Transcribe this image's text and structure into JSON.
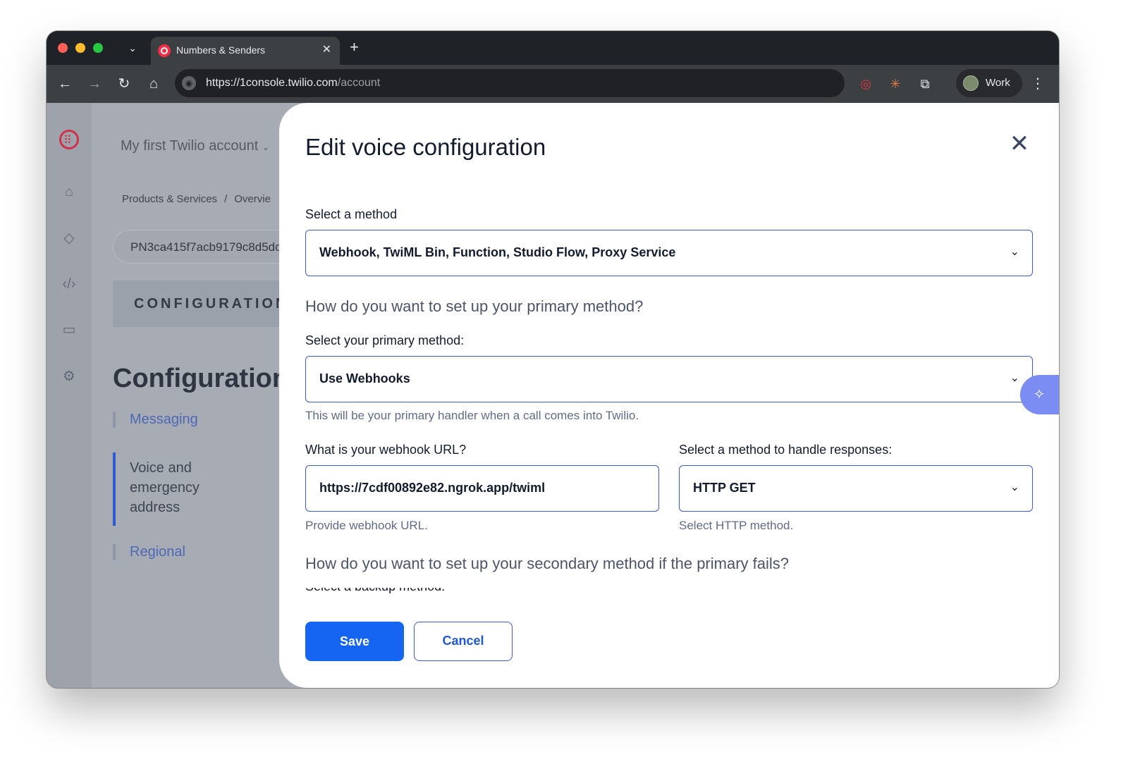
{
  "browser": {
    "tab_title": "Numbers & Senders",
    "new_tab_symbol": "+",
    "url_host": "https://1console.twilio.com",
    "url_path": "/account",
    "profile_label": "Work"
  },
  "background": {
    "account_name": "My first Twilio account",
    "breadcrumb": [
      "Products & Services",
      "/",
      "Overvie"
    ],
    "sid": "PN3ca415f7acb9179c8d5dc",
    "config_banner": "CONFIGURATION D",
    "page_title": "Configuration",
    "sidenav": [
      "Messaging",
      "Voice and emergency address",
      "Regional"
    ]
  },
  "modal": {
    "title": "Edit voice configuration",
    "method_label": "Select a method",
    "method_value": "Webhook, TwiML Bin, Function, Studio Flow, Proxy Service",
    "primary_question": "How do you want to set up your primary method?",
    "primary_label": "Select your primary method:",
    "primary_value": "Use Webhooks",
    "primary_help": "This will be your primary handler when a call comes into Twilio.",
    "webhook_label": "What is your webhook URL?",
    "webhook_value": "https://7cdf00892e82.ngrok.app/twiml",
    "webhook_help": "Provide webhook URL.",
    "http_label": "Select a method to handle responses:",
    "http_value": "HTTP GET",
    "http_help": "Select HTTP method.",
    "secondary_question": "How do you want to set up your secondary method if the primary fails?",
    "secondary_label_cut": "Select a backup method:",
    "save_label": "Save",
    "cancel_label": "Cancel"
  },
  "colors": {
    "primary_button": "#1565f2",
    "input_border": "#3d5ad6",
    "twilio_red": "#f22f46"
  },
  "icons": [
    "tab-menu-icon",
    "twilio-favicon-icon",
    "close-tab-icon",
    "back-icon",
    "forward-icon",
    "reload-icon",
    "home-icon",
    "site-info-icon",
    "twilio-extension-icon",
    "claude-extension-icon",
    "extensions-puzzle-icon",
    "more-menu-icon",
    "twilio-logo-icon",
    "rail-home-icon",
    "rail-products-icon",
    "rail-code-icon",
    "rail-billing-icon",
    "rail-settings-icon",
    "close-modal-icon",
    "chevron-down-icon",
    "assistant-icon"
  ]
}
